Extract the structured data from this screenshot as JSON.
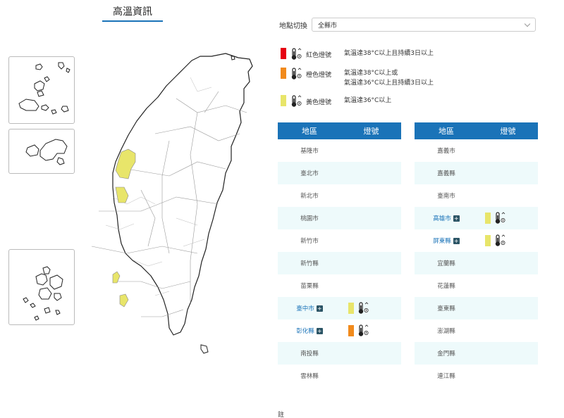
{
  "title": "高溫資訊",
  "location_switch": {
    "label": "地點切換",
    "value": "全縣市"
  },
  "legend": [
    {
      "name": "紅色燈號",
      "color": "#e60012",
      "desc_lines": [
        "氣溫達38°C以上且持續3日以上"
      ]
    },
    {
      "name": "橙色燈號",
      "color": "#f18a1c",
      "desc_lines": [
        "氣溫達38°C以上或",
        "氣溫達36°C以上且持續3日以上"
      ]
    },
    {
      "name": "黃色燈號",
      "color": "#e8e56a",
      "desc_lines": [
        "氣溫達36°C以上"
      ]
    }
  ],
  "table_headers": {
    "region": "地區",
    "signal": "燈號"
  },
  "tables": {
    "left": [
      {
        "name": "基隆市"
      },
      {
        "name": "臺北市"
      },
      {
        "name": "新北市"
      },
      {
        "name": "桃園市"
      },
      {
        "name": "新竹市"
      },
      {
        "name": "新竹縣"
      },
      {
        "name": "苗栗縣"
      },
      {
        "name": "臺中市",
        "signal": "yellow"
      },
      {
        "name": "彰化縣",
        "signal": "orange"
      },
      {
        "name": "南投縣"
      },
      {
        "name": "雲林縣"
      }
    ],
    "right": [
      {
        "name": "嘉義市"
      },
      {
        "name": "嘉義縣"
      },
      {
        "name": "臺南市"
      },
      {
        "name": "高雄市",
        "signal": "yellow"
      },
      {
        "name": "屏東縣",
        "signal": "yellow"
      },
      {
        "name": "宜蘭縣"
      },
      {
        "name": "花蓮縣"
      },
      {
        "name": "臺東縣"
      },
      {
        "name": "澎湖縣"
      },
      {
        "name": "金門縣"
      },
      {
        "name": "連江縣"
      }
    ]
  },
  "signal_colors": {
    "yellow": "#e8e56a",
    "orange": "#f18a1c",
    "red": "#e60012"
  },
  "expand_symbol": "+",
  "footer": "註"
}
